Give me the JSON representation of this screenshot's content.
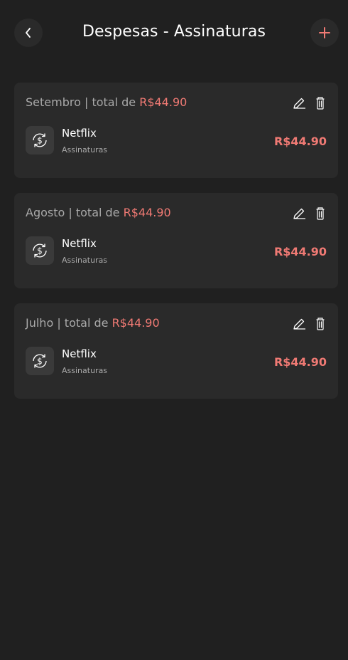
{
  "header": {
    "title": "Despesas - Assinaturas",
    "back_icon": "chevron-left-icon",
    "add_icon": "plus-icon"
  },
  "colors": {
    "background": "#202020",
    "card": "#2a2a2a",
    "accent": "#f07a74",
    "muted": "#a9a9a9"
  },
  "months": [
    {
      "label": "Setembro | total de ",
      "total": "R$44.90",
      "items": [
        {
          "name": "Netflix",
          "category": "Assinaturas",
          "value": "R$44.90",
          "icon": "recurring-payment-icon"
        }
      ]
    },
    {
      "label": "Agosto | total de ",
      "total": "R$44.90",
      "items": [
        {
          "name": "Netflix",
          "category": "Assinaturas",
          "value": "R$44.90",
          "icon": "recurring-payment-icon"
        }
      ]
    },
    {
      "label": "Julho | total de ",
      "total": "R$44.90",
      "items": [
        {
          "name": "Netflix",
          "category": "Assinaturas",
          "value": "R$44.90",
          "icon": "recurring-payment-icon"
        }
      ]
    }
  ]
}
